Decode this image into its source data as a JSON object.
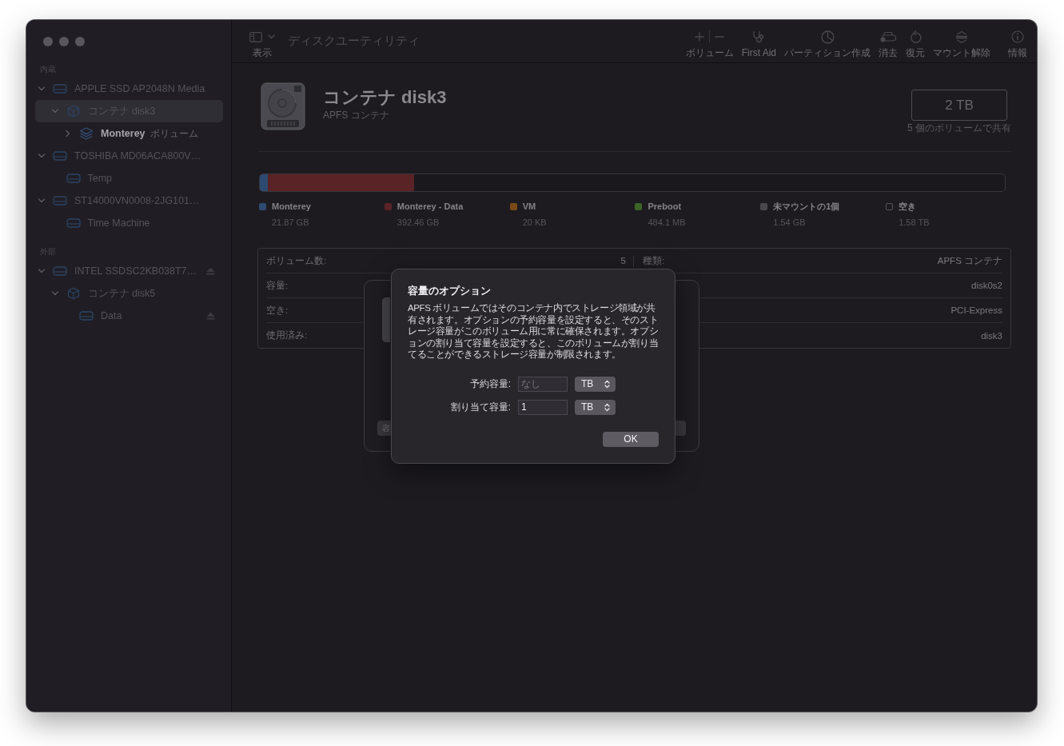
{
  "toolbar": {
    "view": {
      "label": "表示"
    },
    "title": "ディスクユーティリティ",
    "items": [
      {
        "kind": "volume",
        "label": "ボリューム"
      },
      {
        "kind": "first_aid",
        "label": "First Aid"
      },
      {
        "kind": "partition",
        "label": "パーティション作成"
      },
      {
        "kind": "erase",
        "label": "消去"
      },
      {
        "kind": "restore",
        "label": "復元"
      },
      {
        "kind": "unmount",
        "label": "マウント解除"
      },
      {
        "kind": "info",
        "label": "情報"
      }
    ]
  },
  "sidebar": {
    "sections": [
      {
        "title": "内蔵",
        "items": [
          {
            "kind": "drive",
            "label": "APPLE SSD AP2048N Media",
            "expanded": true,
            "selected": false,
            "dimmed": true,
            "eject": false,
            "children": [
              {
                "kind": "container",
                "label": "コンテナ disk3",
                "expanded": true,
                "selected": true,
                "dimmed": true,
                "eject": false,
                "children": [
                  {
                    "kind": "volume",
                    "label": "Monterey",
                    "sublabel": "ボリューム",
                    "expanded": false,
                    "selected": false,
                    "dimmed": false,
                    "eject": false
                  }
                ]
              }
            ]
          },
          {
            "kind": "drive",
            "label": "TOSHIBA MD06ACA800V…",
            "expanded": true,
            "selected": false,
            "dimmed": true,
            "eject": false,
            "children": [
              {
                "kind": "drive",
                "label": "Temp",
                "selected": false,
                "dimmed": true,
                "eject": false
              }
            ]
          },
          {
            "kind": "drive",
            "label": "ST14000VN0008-2JG101…",
            "expanded": true,
            "selected": false,
            "dimmed": true,
            "eject": false,
            "children": [
              {
                "kind": "drive",
                "label": "Time Machine",
                "selected": false,
                "dimmed": true,
                "eject": false
              }
            ]
          }
        ]
      },
      {
        "title": "外部",
        "items": [
          {
            "kind": "drive",
            "label": "INTEL SSDSC2KB038T7…",
            "expanded": true,
            "selected": false,
            "dimmed": true,
            "eject": true,
            "children": [
              {
                "kind": "container",
                "label": "コンテナ disk5",
                "expanded": true,
                "selected": false,
                "dimmed": true,
                "eject": false,
                "children": [
                  {
                    "kind": "drive",
                    "label": "Data",
                    "selected": false,
                    "dimmed": true,
                    "eject": true
                  }
                ]
              }
            ]
          }
        ]
      }
    ]
  },
  "header": {
    "title": "コンテナ disk3",
    "subtitle": "APFS コンテナ",
    "capacity": "2 TB",
    "capacity_note": "5 個のボリュームで共有"
  },
  "usage": {
    "legend": [
      {
        "kind": "used",
        "name": "Monterey",
        "size": "21.87 GB",
        "color": "#2d4a70",
        "level": 0.011
      },
      {
        "kind": "used",
        "name": "Monterey - Data",
        "size": "392.46 GB",
        "color": "#5a2326",
        "level": 0.207
      },
      {
        "kind": "used",
        "name": "VM",
        "size": "20 KB",
        "color": "#7a4a16"
      },
      {
        "kind": "used",
        "name": "Preboot",
        "size": "484.1 MB",
        "color": "#3b6427"
      },
      {
        "kind": "used",
        "name": "未マウントの1個",
        "size": "1.54 GB",
        "color": "#4a484e"
      },
      {
        "kind": "free",
        "name": "空き",
        "size": "1.58 TB"
      }
    ]
  },
  "info_table": {
    "rows": [
      {
        "left_label": "ボリューム数:",
        "left_value": "5",
        "right_label": "種類:",
        "right_value": "APFS コンテナ"
      },
      {
        "left_label": "容量:",
        "right_value": "disk0s2"
      },
      {
        "left_label": "空き:",
        "right_value": "PCI-Express"
      },
      {
        "left_label": "使用済み:",
        "right_value": "disk3"
      }
    ]
  },
  "background_sheet": {
    "button": {
      "label": "容"
    }
  },
  "dialog": {
    "title": "容量のオプション",
    "message": "APFS ボリュームではそのコンテナ内でストレージ領域が共有されます。オプションの予約容量を設定すると、そのストレージ容量がこのボリューム用に常に確保されます。オプションの割り当て容量を設定すると、このボリュームが割り当てることができるストレージ容量が制限されます。",
    "fields": [
      {
        "label": "予約容量:",
        "placeholder": "なし",
        "unit": "TB"
      },
      {
        "label": "割り当て容量:",
        "value": "1",
        "unit": "TB"
      }
    ],
    "buttons": [
      {
        "label": "OK"
      }
    ]
  }
}
